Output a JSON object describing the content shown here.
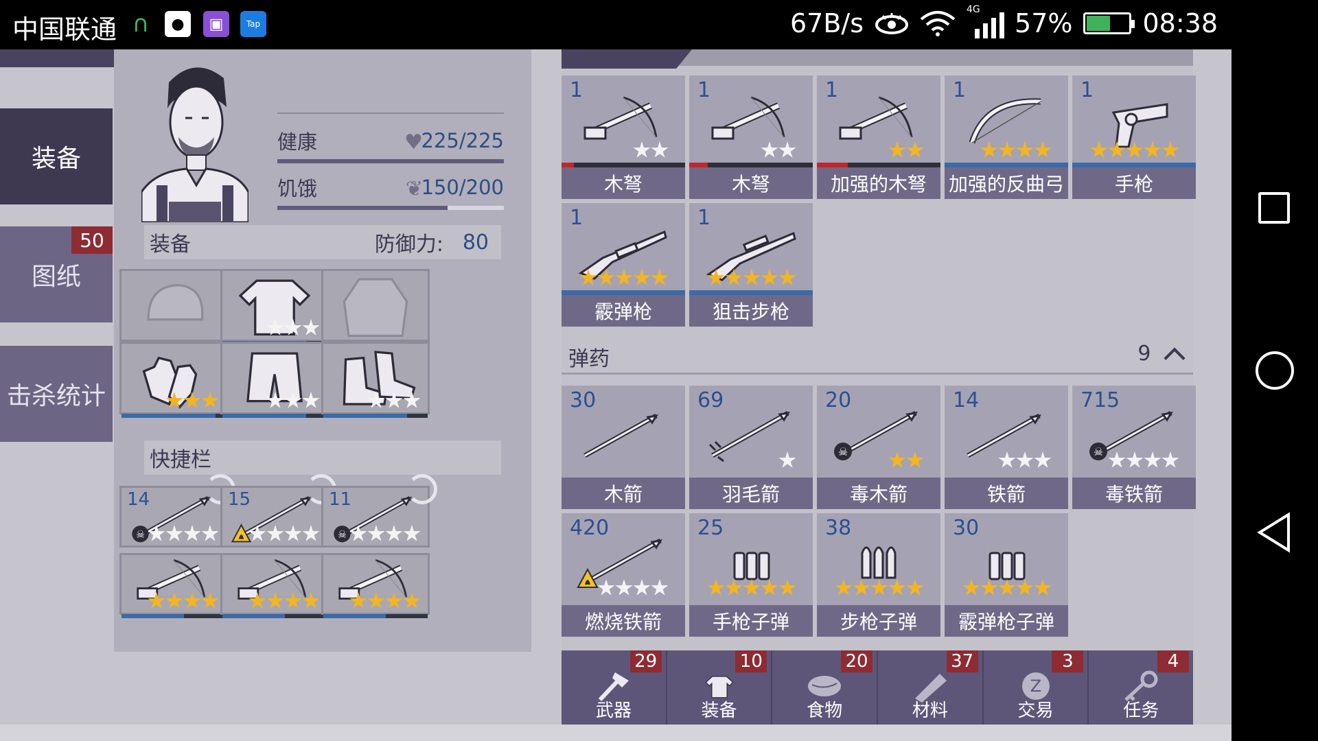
{
  "status_bar": {
    "carrier": "中国联通",
    "speed": "67B/s",
    "network": "4G",
    "battery": "57%",
    "time": "08:38"
  },
  "tabs": [
    {
      "label": "装备",
      "active": true
    },
    {
      "label": "图纸",
      "badge": "50"
    },
    {
      "label": "击杀统计"
    }
  ],
  "character": {
    "health_label": "健康",
    "health_value": "225/225",
    "health_fill": 1.0,
    "hunger_label": "饥饿",
    "hunger_value": "150/200",
    "hunger_fill": 0.75,
    "equipment_label": "装备",
    "defense_label": "防御力:",
    "defense_value": "80",
    "quickbar_label": "快捷栏",
    "equipment_slots": [
      {
        "icon": "hat-icon",
        "stars": 0,
        "empty": true
      },
      {
        "icon": "shirt-icon",
        "stars": 3,
        "gold": 0,
        "durability": 0.8
      },
      {
        "icon": "jacket-icon",
        "stars": 0,
        "empty": true
      },
      {
        "icon": "gloves-icon",
        "stars": 3,
        "gold": 3,
        "durability": 0.9
      },
      {
        "icon": "shorts-icon",
        "stars": 3,
        "gold": 0,
        "durability": 0.8
      },
      {
        "icon": "boots-icon",
        "stars": 3,
        "gold": 0,
        "durability": 0.8
      }
    ],
    "quick_slots": [
      {
        "count": "14",
        "icon": "poison-arrow-icon",
        "stars": 4,
        "gold": 0
      },
      {
        "count": "15",
        "icon": "fire-arrow-icon",
        "stars": 4,
        "gold": 0
      },
      {
        "count": "11",
        "icon": "poison-arrow-icon",
        "stars": 4,
        "gold": 0
      },
      {
        "icon": "crossbow-icon",
        "stars": 4,
        "gold": 4,
        "durability": 0.6
      },
      {
        "icon": "crossbow-icon",
        "stars": 4,
        "gold": 4,
        "durability": 0.6
      },
      {
        "icon": "crossbow-icon",
        "stars": 4,
        "gold": 4,
        "durability": 0.6
      }
    ]
  },
  "weapons": [
    {
      "count": "1",
      "name": "木弩",
      "icon": "crossbow-icon",
      "stars": 2,
      "gold": 0,
      "durability": 0.1,
      "dur_color": "#c0262c"
    },
    {
      "count": "1",
      "name": "木弩",
      "icon": "crossbow-icon",
      "stars": 2,
      "gold": 0,
      "durability": 0.15,
      "dur_color": "#c0262c"
    },
    {
      "count": "1",
      "name": "加强的木弩",
      "icon": "crossbow-icon",
      "stars": 2,
      "gold": 2,
      "durability": 0.25,
      "dur_color": "#c0262c"
    },
    {
      "count": "1",
      "name": "加强的反曲弓",
      "icon": "bow-icon",
      "stars": 4,
      "gold": 4,
      "durability": 1.0,
      "dur_color": "#3b6aa8"
    },
    {
      "count": "1",
      "name": "手枪",
      "icon": "pistol-icon",
      "stars": 5,
      "gold": 5,
      "durability": 1.0,
      "dur_color": "#3b6aa8"
    },
    {
      "count": "1",
      "name": "霰弹枪",
      "icon": "shotgun-icon",
      "stars": 5,
      "gold": 5,
      "durability": 1.0,
      "dur_color": "#3b6aa8"
    },
    {
      "count": "1",
      "name": "狙击步枪",
      "icon": "sniper-icon",
      "stars": 5,
      "gold": 5,
      "durability": 1.0,
      "dur_color": "#3b6aa8"
    }
  ],
  "ammo_header": {
    "label": "弹药",
    "count": "9"
  },
  "ammo": [
    {
      "count": "30",
      "name": "木箭",
      "icon": "arrow-icon",
      "stars": 0,
      "gold": 0
    },
    {
      "count": "69",
      "name": "羽毛箭",
      "icon": "feather-arrow-icon",
      "stars": 1,
      "gold": 0
    },
    {
      "count": "20",
      "name": "毒木箭",
      "icon": "poison-arrow-icon",
      "stars": 2,
      "gold": 2
    },
    {
      "count": "14",
      "name": "铁箭",
      "icon": "iron-arrow-icon",
      "stars": 3,
      "gold": 0
    },
    {
      "count": "715",
      "name": "毒铁箭",
      "icon": "poison-arrow-icon",
      "stars": 4,
      "gold": 0
    },
    {
      "count": "420",
      "name": "燃烧铁箭",
      "icon": "fire-arrow-icon",
      "stars": 4,
      "gold": 0
    },
    {
      "count": "25",
      "name": "手枪子弹",
      "icon": "pistol-ammo-icon",
      "stars": 5,
      "gold": 5
    },
    {
      "count": "38",
      "name": "步枪子弹",
      "icon": "rifle-ammo-icon",
      "stars": 5,
      "gold": 5
    },
    {
      "count": "30",
      "name": "霰弹枪子弹",
      "icon": "shotgun-ammo-icon",
      "stars": 5,
      "gold": 5
    }
  ],
  "categories": [
    {
      "label": "武器",
      "badge": "29",
      "icon": "axe-icon"
    },
    {
      "label": "装备",
      "badge": "10",
      "icon": "tshirt-icon"
    },
    {
      "label": "食物",
      "badge": "20",
      "icon": "meat-icon"
    },
    {
      "label": "材料",
      "badge": "37",
      "icon": "log-icon"
    },
    {
      "label": "交易",
      "badge": "3",
      "icon": "coin-icon"
    },
    {
      "label": "任务",
      "badge": "4",
      "icon": "key-icon"
    }
  ]
}
